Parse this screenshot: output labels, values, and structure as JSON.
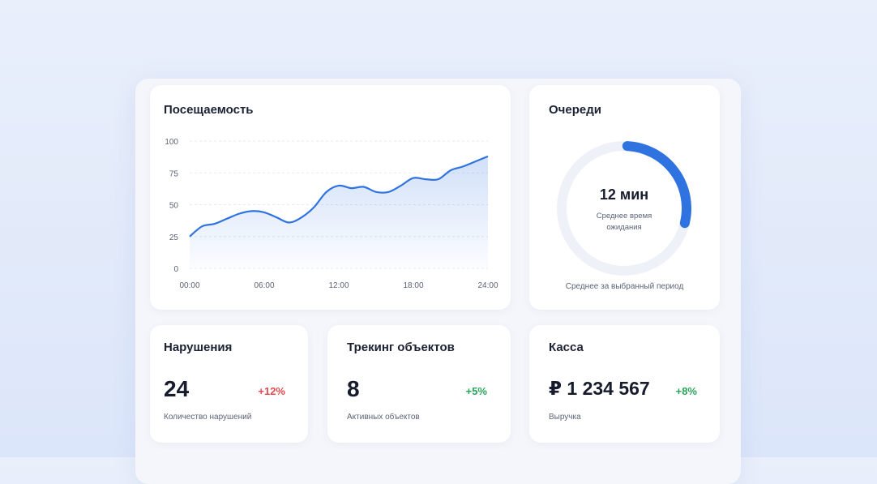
{
  "colors": {
    "accent": "#2f73e0",
    "positive": "#28a55a",
    "negative": "#e5484d",
    "ring_track": "#eef1f7"
  },
  "visits": {
    "title": "Посещаемость",
    "chart_data": {
      "type": "area",
      "title": "Посещаемость",
      "xlabel": "",
      "ylabel": "",
      "x_ticks": [
        "00:00",
        "06:00",
        "12:00",
        "18:00",
        "24:00"
      ],
      "y_ticks": [
        "0",
        "25",
        "50",
        "75",
        "100"
      ],
      "ylim": [
        0,
        100
      ],
      "xlim": [
        0,
        24
      ],
      "grid": true,
      "series": [
        {
          "x": [
            0,
            1,
            2,
            3,
            4,
            5,
            6,
            7,
            8,
            9,
            10,
            11,
            12,
            13,
            14,
            15,
            16,
            17,
            18,
            19,
            20,
            21,
            22,
            23,
            24
          ],
          "y": [
            25,
            33,
            35,
            39,
            43,
            45,
            44,
            40,
            36,
            40,
            48,
            60,
            65,
            63,
            64,
            60,
            60,
            65,
            71,
            70,
            70,
            77,
            80,
            84,
            88
          ]
        }
      ]
    }
  },
  "queues": {
    "title": "Очереди",
    "value": "12 мин",
    "caption": "Среднее время ожидания",
    "footer": "Среднее за выбранный период",
    "progress": 0.28
  },
  "violations": {
    "title": "Нарушения",
    "value": "24",
    "delta": "+12%",
    "caption": "Количество нарушений"
  },
  "tracking": {
    "title": "Трекинг объектов",
    "value": "8",
    "delta": "+5%",
    "caption": "Активных объектов"
  },
  "cash": {
    "title": "Касса",
    "value": "₽ 1 234 567",
    "delta": "+8%",
    "caption": "Выручка"
  }
}
